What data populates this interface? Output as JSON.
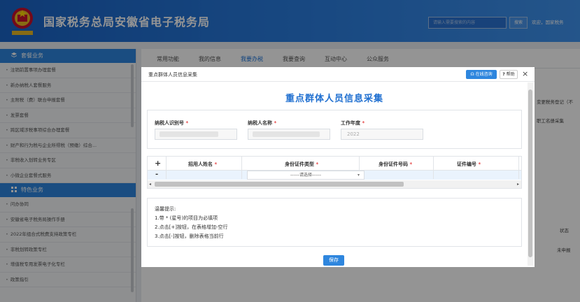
{
  "header": {
    "title": "国家税务总局安徽省电子税务局",
    "search_placeholder": "请输入需要搜索的内容",
    "search_button": "搜索",
    "welcome": "欢迎，国家税务"
  },
  "sidebar": {
    "section1": "套餐业务",
    "items1": [
      "注销前置事项办理套餐",
      "新办纳税人套餐服务",
      "主附税（费）联合申报套餐",
      "发票套餐",
      "跨区域涉税事项综合办理套餐",
      "财产和行为税与企业所得税（预缴）综合...",
      "非税收入划转业务专区",
      "小微企业套餐式服务"
    ],
    "section2": "特色业务",
    "items2": [
      "问办协同",
      "安徽省电子税务局操作手册",
      "2022年组合式税费支持政策专栏",
      "非税划转政策专栏",
      "增值税专用发票电子化专栏",
      "政策指引"
    ]
  },
  "main": {
    "tabs": [
      "常用功能",
      "我的信息",
      "我要办税",
      "我要查询",
      "互动中心",
      "公众服务"
    ],
    "right_texts": [
      "变更税务登记（不",
      "职工名册采集",
      "状态",
      "未申报"
    ]
  },
  "modal": {
    "title": "重点群体人员信息采集",
    "online_btn": "在线咨询",
    "help_btn": "帮助",
    "close": "×",
    "heading": "重点群体人员信息采集",
    "fields": {
      "taxpayer_id_label": "纳税人识别号",
      "taxpayer_name_label": "纳税人名称",
      "year_label": "工作年度",
      "year_value": "2022",
      "required_mark": "*"
    },
    "table": {
      "plus": "+",
      "minus": "-",
      "headers": [
        "招用人姓名",
        "身份证件类型",
        "身份证件号码",
        "证件编号"
      ],
      "select_placeholder": "------请选择------"
    },
    "tips": {
      "title": "温馨提示:",
      "lines": [
        "1.带 * (星号)的项目为必填项",
        "2.点击[+]按钮，在表格增加-空行",
        "3.点击[-]按钮，删除表格当前行"
      ]
    },
    "save": "保存"
  },
  "colors": {
    "brand_blue": "#2e86de",
    "heading_blue": "#1f6fd0",
    "required_red": "#e54545"
  }
}
